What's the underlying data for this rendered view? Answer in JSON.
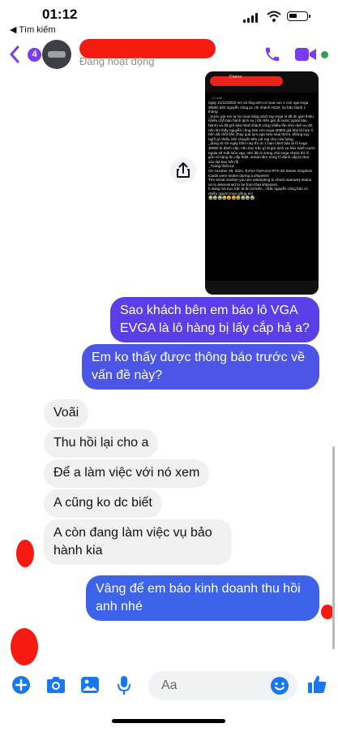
{
  "status_bar": {
    "time": "01:12",
    "back_app": "◀ Tìm kiếm"
  },
  "header": {
    "unread_count": "4",
    "presence": "Đang hoạt động"
  },
  "attachment": {
    "title": "Drama",
    "subtitle": "13 phút · ",
    "text": "ngày 21/12/2020 em và ông anh có mua con 1 con vga evga 3080ti bên nguyễn công pc chi nhánh HCM, họ bảo hành 1 tháng\n_trước giờ em tự tin mua hàng xách tay evga vì đã đc giới thiệu nhiều chỗ bảo hành dịch vụ ( tốn tiền gửi đi nước ngoài bảo hành) và đã gửi bảo hành thành công nhiều lần nhờ dịch vụ đó, nên khi thấy nguyễn công bán con evga 3080ti giá khá là hợp lí nên đã chốt liền chạy qua lụm,vga new seal thơm, không suy nghĩ gì nhiều nên chuyển tiền cái rụp cho cửa hàng.\n_dùng dc tới ngày hôm nay thì dc 1 bạn cảnh báo là lô evga 3080ti bị đánh cắp, nếu trục trặc gì đi gửi dịch vụ bảo hành nước ngoài sẽ mất luôn vga, nên đã zo trang chủ evga check thì ôi giời ơi hàng ăn cắp thiệt, serial nằm trong lô đánh cắp,bị đưa vào list ban hết rồi\n_Toang thiệt sự.\nOn October 29, 2021, EVGA GeForce RTX-30 Series Graphics Cards were stolen during a shipment\nThe serial number you are attempting to check warranty status on is determined to be from that shipment.\nh dùng mà trục trặc là ăn lol luôn , chắc nguyễn công bán có nhiều người mua giống em\n😭😭😭😭😭😭😭😭😭😭"
  },
  "messages": [
    {
      "side": "out",
      "text": "Sao khách bên em báo lô VGA EVGA là lô hàng bị lấy cắp hả a?"
    },
    {
      "side": "out",
      "text": "Em ko thấy được thông báo trước về vấn đề này?"
    },
    {
      "side": "in",
      "text": "Voãi"
    },
    {
      "side": "in",
      "text": "Thu hồi lại cho a"
    },
    {
      "side": "in",
      "text": "Để a làm việc với nó xem"
    },
    {
      "side": "in",
      "text": "A cũng ko dc biết"
    },
    {
      "side": "in",
      "text": "A còn đang làm việc vụ bảo hành kia"
    },
    {
      "side": "out",
      "text": "Vâng để em báo kinh doanh thu hồi anh nhé"
    }
  ],
  "composer": {
    "placeholder": "Aa"
  },
  "colors": {
    "accent": "#7b3cf0",
    "outgoing_top": "#5a3ee8",
    "outgoing_bottom": "#3d63ea",
    "incoming": "#f0f0f0",
    "online": "#31a24c",
    "icon_blue": "#1877f2"
  }
}
